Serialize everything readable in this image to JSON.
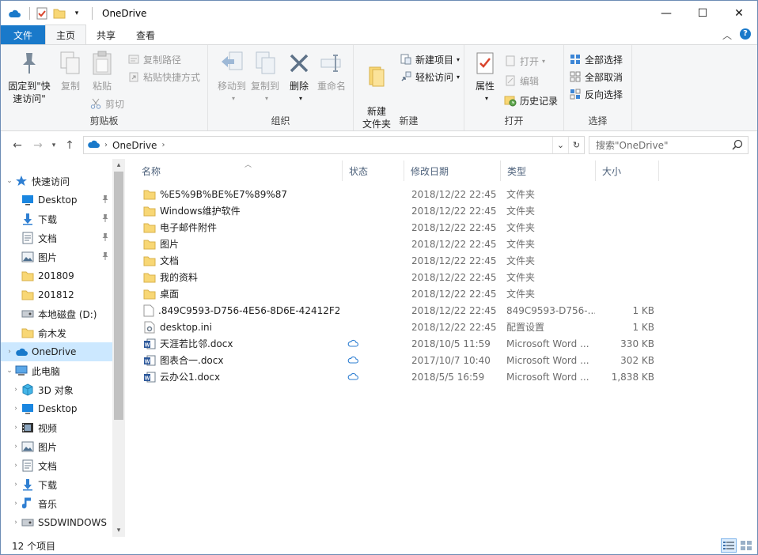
{
  "window": {
    "title": "OneDrive",
    "controls": {
      "minimize": "—",
      "maximize": "☐",
      "close": "✕"
    }
  },
  "ribbon_tabs": [
    "文件",
    "主页",
    "共享",
    "查看"
  ],
  "ribbon": {
    "clipboard": {
      "label": "剪贴板",
      "pin": "固定到\"快速访问\"",
      "copy": "复制",
      "paste": "粘贴",
      "copy_path": "复制路径",
      "paste_shortcut": "粘贴快捷方式",
      "cut": "剪切"
    },
    "organize": {
      "label": "组织",
      "move_to": "移动到",
      "copy_to": "复制到",
      "delete": "删除",
      "rename": "重命名"
    },
    "new": {
      "label": "新建",
      "new_folder": "新建\n文件夹",
      "new_item": "新建项目",
      "easy_access": "轻松访问"
    },
    "open": {
      "label": "打开",
      "properties": "属性",
      "open": "打开",
      "edit": "编辑",
      "history": "历史记录"
    },
    "select": {
      "label": "选择",
      "select_all": "全部选择",
      "select_none": "全部取消",
      "invert": "反向选择"
    }
  },
  "address": {
    "crumbs": [
      "OneDrive"
    ],
    "search_placeholder": "搜索\"OneDrive\""
  },
  "nav": {
    "items": [
      {
        "label": "快速访问",
        "icon": "star-icon",
        "level": 0,
        "expander": "open",
        "pinned": false
      },
      {
        "label": "Desktop",
        "icon": "desktop-icon",
        "level": 1,
        "expander": "none",
        "pinned": true
      },
      {
        "label": "下载",
        "icon": "download-icon",
        "level": 1,
        "expander": "none",
        "pinned": true
      },
      {
        "label": "文档",
        "icon": "document-icon",
        "level": 1,
        "expander": "none",
        "pinned": true
      },
      {
        "label": "图片",
        "icon": "picture-icon",
        "level": 1,
        "expander": "none",
        "pinned": true
      },
      {
        "label": "201809",
        "icon": "folder-icon",
        "level": 1,
        "expander": "none",
        "pinned": false
      },
      {
        "label": "201812",
        "icon": "folder-icon",
        "level": 1,
        "expander": "none",
        "pinned": false
      },
      {
        "label": "本地磁盘 (D:)",
        "icon": "disk-icon",
        "level": 1,
        "expander": "none",
        "pinned": false
      },
      {
        "label": "俞木发",
        "icon": "folder-icon",
        "level": 1,
        "expander": "none",
        "pinned": false
      },
      {
        "label": "OneDrive",
        "icon": "cloud-icon",
        "level": 0,
        "expander": "closed",
        "pinned": false,
        "selected": true
      },
      {
        "label": "此电脑",
        "icon": "computer-icon",
        "level": 0,
        "expander": "open",
        "pinned": false
      },
      {
        "label": "3D 对象",
        "icon": "cube-icon",
        "level": 1,
        "expander": "closed",
        "pinned": false
      },
      {
        "label": "Desktop",
        "icon": "desktop-icon",
        "level": 1,
        "expander": "closed",
        "pinned": false
      },
      {
        "label": "视频",
        "icon": "video-icon",
        "level": 1,
        "expander": "closed",
        "pinned": false
      },
      {
        "label": "图片",
        "icon": "picture-icon",
        "level": 1,
        "expander": "closed",
        "pinned": false
      },
      {
        "label": "文档",
        "icon": "document-icon",
        "level": 1,
        "expander": "closed",
        "pinned": false
      },
      {
        "label": "下载",
        "icon": "download-icon",
        "level": 1,
        "expander": "closed",
        "pinned": false
      },
      {
        "label": "音乐",
        "icon": "music-icon",
        "level": 1,
        "expander": "closed",
        "pinned": false
      },
      {
        "label": "SSDWINDOWS",
        "icon": "disk-icon",
        "level": 1,
        "expander": "closed",
        "pinned": false
      }
    ]
  },
  "columns": [
    "名称",
    "状态",
    "修改日期",
    "类型",
    "大小"
  ],
  "files": [
    {
      "name": "%E5%9B%BE%E7%89%87",
      "icon": "folder-icon",
      "status": "",
      "modified": "2018/12/22 22:45",
      "type": "文件夹",
      "size": ""
    },
    {
      "name": "Windows维护软件",
      "icon": "folder-icon",
      "status": "",
      "modified": "2018/12/22 22:45",
      "type": "文件夹",
      "size": ""
    },
    {
      "name": "电子邮件附件",
      "icon": "folder-icon",
      "status": "",
      "modified": "2018/12/22 22:45",
      "type": "文件夹",
      "size": ""
    },
    {
      "name": "图片",
      "icon": "folder-icon",
      "status": "",
      "modified": "2018/12/22 22:45",
      "type": "文件夹",
      "size": ""
    },
    {
      "name": "文档",
      "icon": "folder-icon",
      "status": "",
      "modified": "2018/12/22 22:45",
      "type": "文件夹",
      "size": ""
    },
    {
      "name": "我的资料",
      "icon": "folder-icon",
      "status": "",
      "modified": "2018/12/22 22:45",
      "type": "文件夹",
      "size": ""
    },
    {
      "name": "桌面",
      "icon": "folder-icon",
      "status": "",
      "modified": "2018/12/22 22:45",
      "type": "文件夹",
      "size": ""
    },
    {
      "name": ".849C9593-D756-4E56-8D6E-42412F2...",
      "icon": "blank-file-icon",
      "status": "",
      "modified": "2018/12/22 22:45",
      "type": "849C9593-D756-...",
      "size": "1 KB"
    },
    {
      "name": "desktop.ini",
      "icon": "settings-file-icon",
      "status": "",
      "modified": "2018/12/22 22:45",
      "type": "配置设置",
      "size": "1 KB"
    },
    {
      "name": "天涯若比邻.docx",
      "icon": "word-icon",
      "status": "cloud",
      "modified": "2018/10/5 11:59",
      "type": "Microsoft Word ...",
      "size": "330 KB"
    },
    {
      "name": "图表合一.docx",
      "icon": "word-icon",
      "status": "cloud",
      "modified": "2017/10/7 10:40",
      "type": "Microsoft Word ...",
      "size": "302 KB"
    },
    {
      "name": "云办公1.docx",
      "icon": "word-icon",
      "status": "cloud",
      "modified": "2018/5/5 16:59",
      "type": "Microsoft Word ...",
      "size": "1,838 KB"
    }
  ],
  "status": {
    "count_text": "12 个项目"
  },
  "colors": {
    "accent": "#1979ca",
    "selected": "#cce8ff",
    "folder": "#f8d775"
  }
}
